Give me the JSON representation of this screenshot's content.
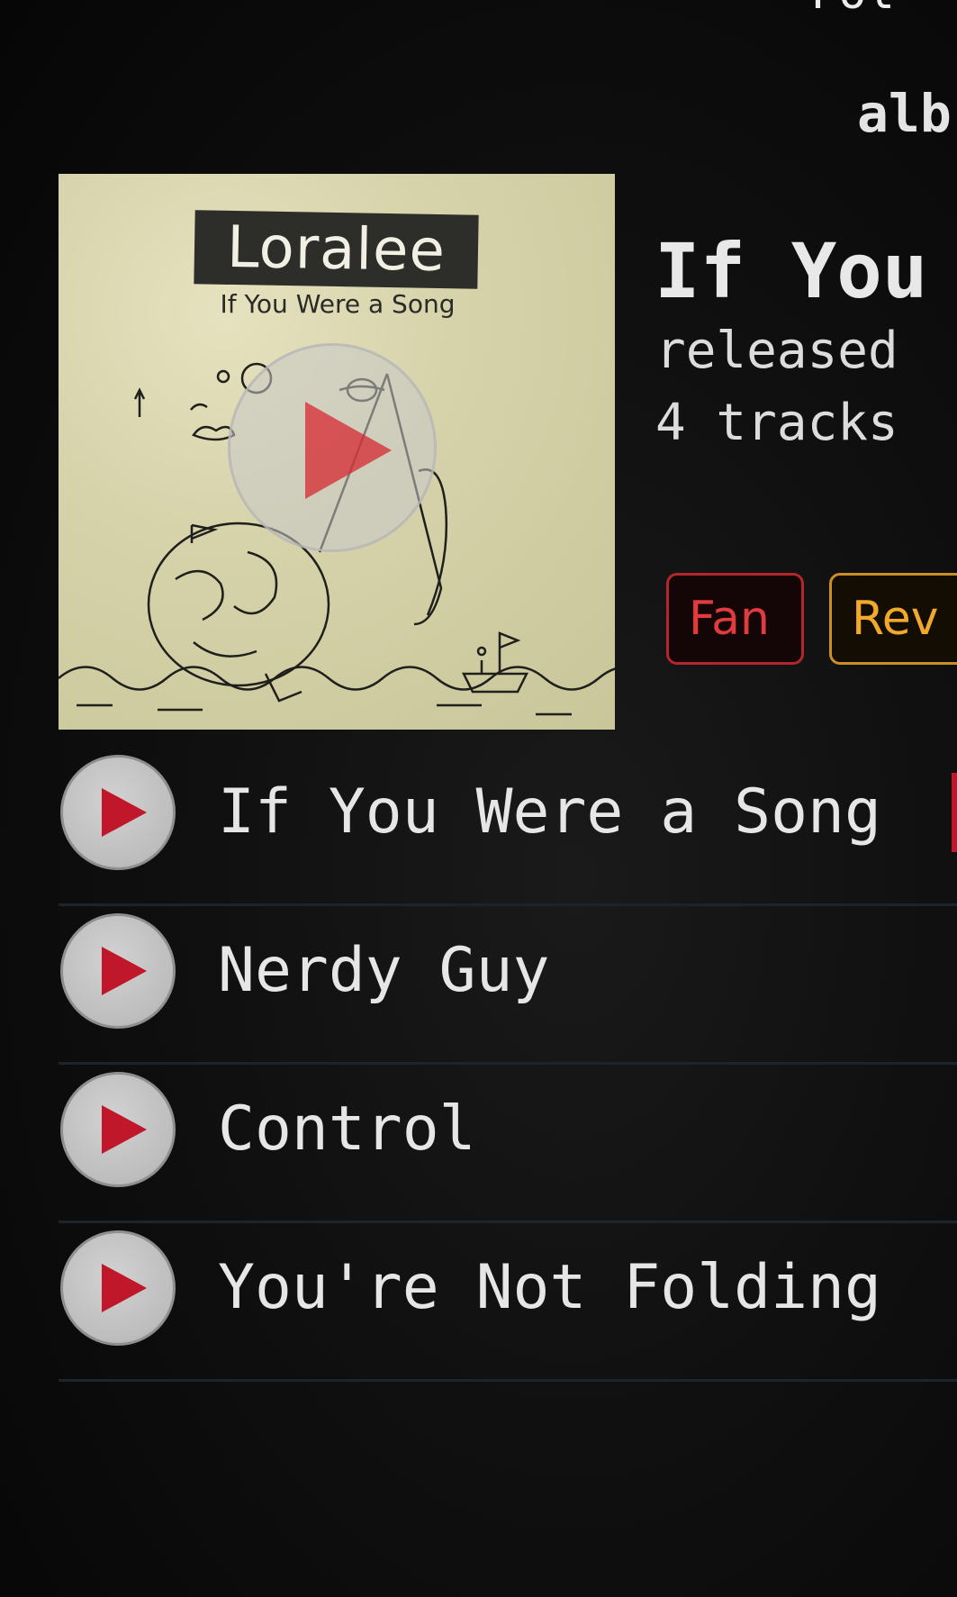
{
  "page": {
    "section_label": "alb",
    "top_partial_text": "Fol"
  },
  "album": {
    "cover": {
      "artist": "Loralee",
      "subtitle": "If You Were a Song"
    },
    "title": "If You",
    "released": "released",
    "track_count": "4 tracks"
  },
  "badges": {
    "fan": "Fan",
    "review": "Rev"
  },
  "tracks": [
    {
      "name": "If You Were a Song",
      "playing": true
    },
    {
      "name": "Nerdy Guy",
      "playing": false
    },
    {
      "name": "Control",
      "playing": false
    },
    {
      "name": "You're Not Folding",
      "playing": false
    }
  ],
  "colors": {
    "accent_red": "#c0182a",
    "badge_fan_red": "#e23b3f",
    "badge_review_orange": "#f0a92b",
    "background": "#0b0b0b"
  },
  "icons": {
    "cover_play": "play-icon",
    "track_play": "play-icon"
  }
}
